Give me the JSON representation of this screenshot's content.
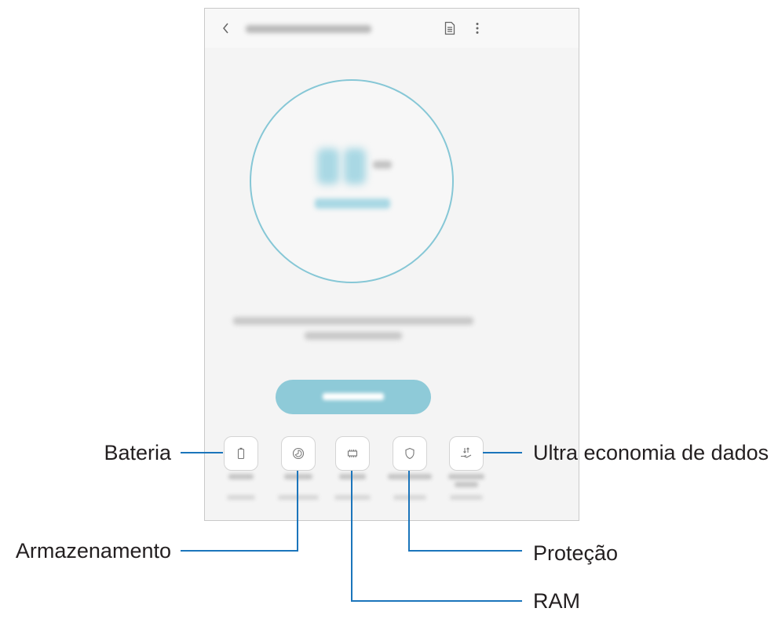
{
  "callouts": {
    "battery": "Bateria",
    "storage": "Armazenamento",
    "ram": "RAM",
    "security": "Proteção",
    "data_saver": "Ultra economia de dados"
  },
  "icons": {
    "back": "chevron-left-icon",
    "report": "document-icon",
    "more": "more-vertical-icon",
    "battery": "battery-icon",
    "storage": "storage-icon",
    "ram": "memory-chip-icon",
    "security": "shield-icon",
    "data_saver": "data-saver-icon"
  },
  "colors": {
    "callout_line": "#1b75bb",
    "accent": "#8ecad8",
    "score_ring": "#86c7d6",
    "label_text": "#231f20"
  }
}
